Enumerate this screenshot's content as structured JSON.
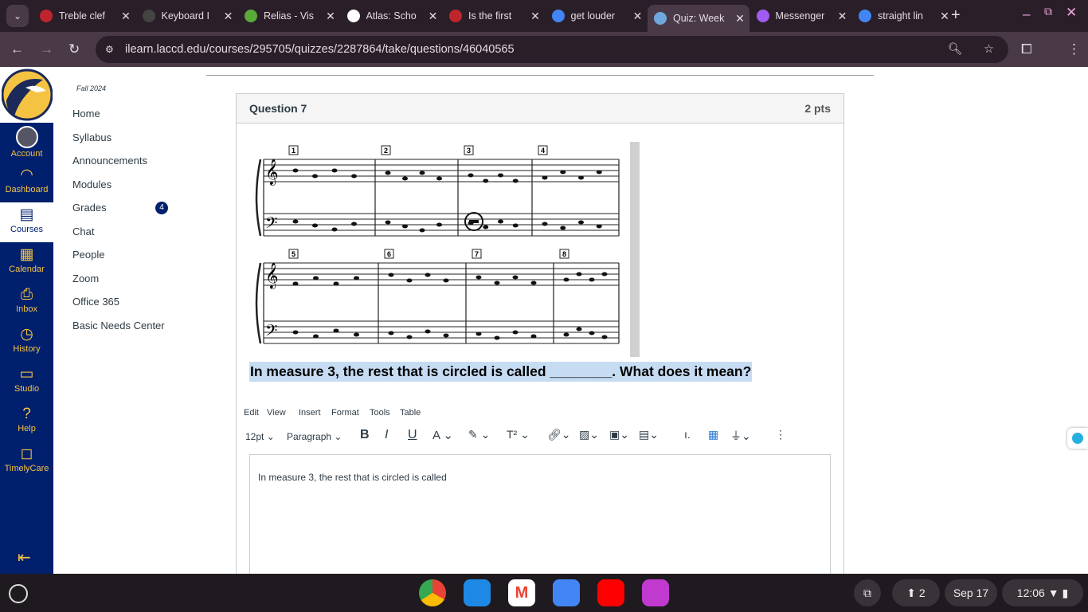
{
  "browser": {
    "tabs": [
      {
        "title": "Treble clef",
        "color": "#c0252b"
      },
      {
        "title": "Keyboard I",
        "color": "#444"
      },
      {
        "title": "Relias - Vis",
        "color": "#5aaa3a"
      },
      {
        "title": "Atlas: Scho",
        "color": "#fff"
      },
      {
        "title": "Is the first",
        "color": "#c0252b"
      },
      {
        "title": "get louder",
        "color": "#4285f4"
      },
      {
        "title": "Quiz: Week",
        "color": "#6fa8dc"
      },
      {
        "title": "Messenger",
        "color": "#a05cf0"
      },
      {
        "title": "straight lin",
        "color": "#4285f4"
      }
    ],
    "active_tab": 6,
    "url": "ilearn.laccd.edu/courses/295705/quizzes/2287864/take/questions/46040565"
  },
  "global_nav": [
    {
      "label": "Account",
      "icon": "avatar"
    },
    {
      "label": "Dashboard",
      "icon": "gauge-icon"
    },
    {
      "label": "Courses",
      "icon": "book-icon"
    },
    {
      "label": "Calendar",
      "icon": "calendar-icon"
    },
    {
      "label": "Inbox",
      "icon": "inbox-icon"
    },
    {
      "label": "History",
      "icon": "clock-icon"
    },
    {
      "label": "Studio",
      "icon": "studio-icon"
    },
    {
      "label": "Help",
      "icon": "help-icon"
    },
    {
      "label": "TimelyCare",
      "icon": "chat-icon"
    }
  ],
  "course_nav": {
    "term": "Fall 2024",
    "items": [
      "Home",
      "Syllabus",
      "Announcements",
      "Modules",
      "Grades",
      "Chat",
      "People",
      "Zoom",
      "Office 365",
      "Basic Needs Center"
    ],
    "grades_badge": "4"
  },
  "question": {
    "title": "Question 7",
    "points": "2 pts",
    "measures": [
      "1",
      "2",
      "3",
      "4",
      "5",
      "6",
      "7",
      "8"
    ],
    "text": "In measure 3, the rest that is circled is called ________. What does it mean?"
  },
  "editor": {
    "menu": [
      "Edit",
      "View",
      "Insert",
      "Format",
      "Tools",
      "Table"
    ],
    "font_size": "12pt",
    "block": "Paragraph",
    "content": "In measure 3, the rest that is circled is called"
  },
  "taskbar": {
    "notifications": "2",
    "date": "Sep 17",
    "time": "12:06"
  }
}
